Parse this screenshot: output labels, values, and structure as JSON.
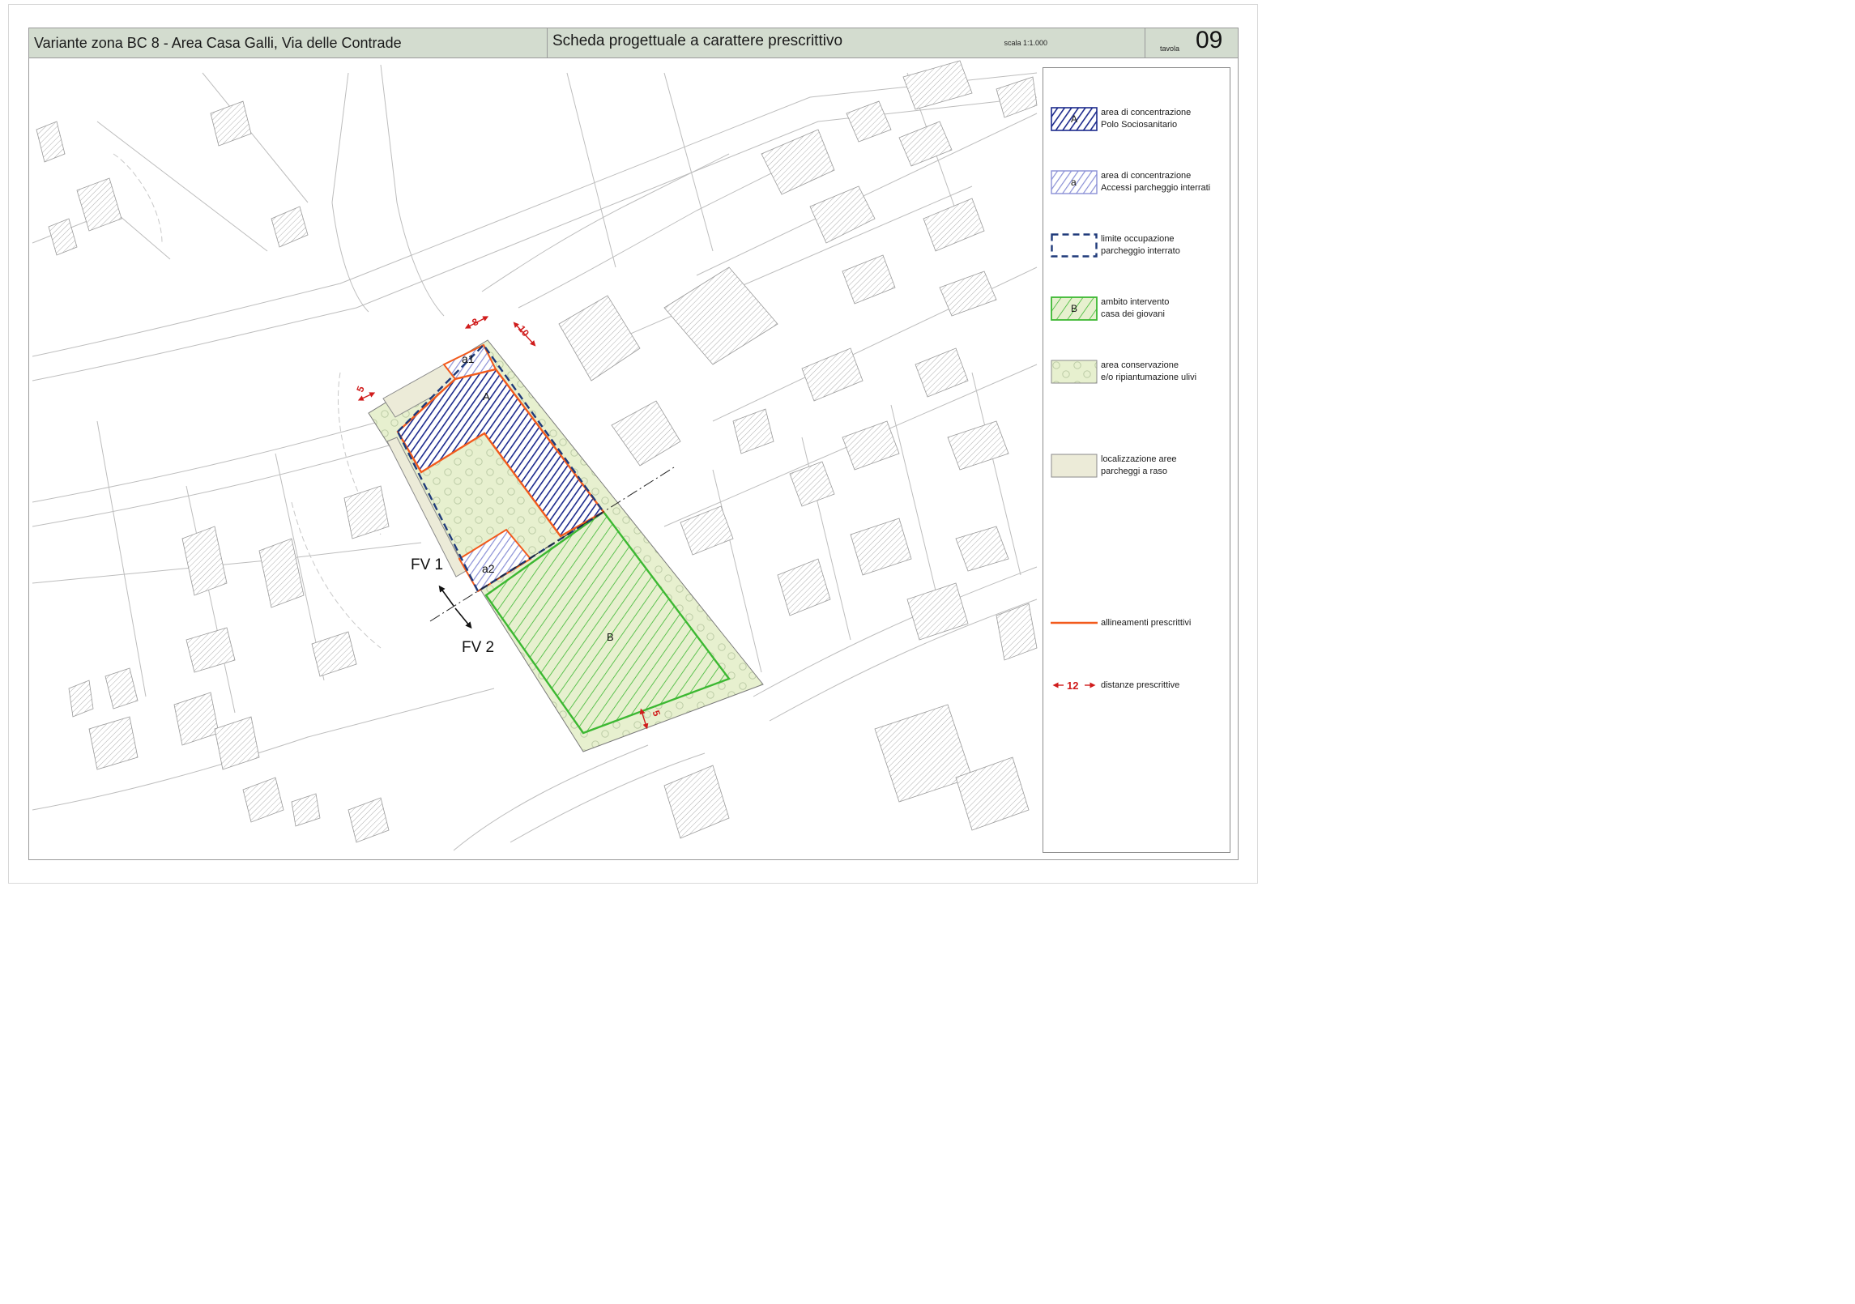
{
  "header": {
    "title": "Variante zona BC 8 - Area Casa Galli, Via delle Contrade",
    "subtitle": "Scheda progettuale a carattere prescrittivo",
    "scale": "scala 1:1.000",
    "tavola_label": "tavola",
    "tavola_number": "09"
  },
  "map": {
    "labels": {
      "area_A": "A",
      "area_a1": "a1",
      "area_a2": "a2",
      "area_B": "B",
      "section_fv1": "FV 1",
      "section_fv2": "FV 2"
    },
    "dimensions": {
      "d5_left": "5",
      "d8": "8",
      "d10": "10",
      "d5_bottom": "5"
    }
  },
  "legend": {
    "items": [
      {
        "key": "A",
        "line1": "area di concentrazione",
        "line2": "Polo Sociosanitario"
      },
      {
        "key": "a",
        "line1": "area di concentrazione",
        "line2": "Accessi parcheggio interrati"
      },
      {
        "key": "",
        "line1": "limite occupazione",
        "line2": "parcheggio interrato"
      },
      {
        "key": "B",
        "line1": "ambito intervento",
        "line2": "casa dei giovani"
      },
      {
        "key": "",
        "line1": "area conservazione",
        "line2": "e/o ripiantumazione ulivi"
      },
      {
        "key": "",
        "line1": "localizzazione aree",
        "line2": "parcheggi a raso"
      },
      {
        "key": "",
        "line1": "allineamenti prescrittivi",
        "line2": ""
      },
      {
        "key": "12",
        "line1": "distanze prescrittive",
        "line2": ""
      }
    ]
  },
  "colors": {
    "header_bg": "#d3dccf",
    "polo_blue": "#1c2a8c",
    "accessi_blue": "#8a90d6",
    "limite_blue": "#1f3a7a",
    "casa_green": "#3cb832",
    "ulivi_fill": "#e7f0cf",
    "parcheggi_fill": "#ecebd8",
    "allineamenti_orange": "#f25a1c",
    "distanze_red": "#d01c1c"
  }
}
